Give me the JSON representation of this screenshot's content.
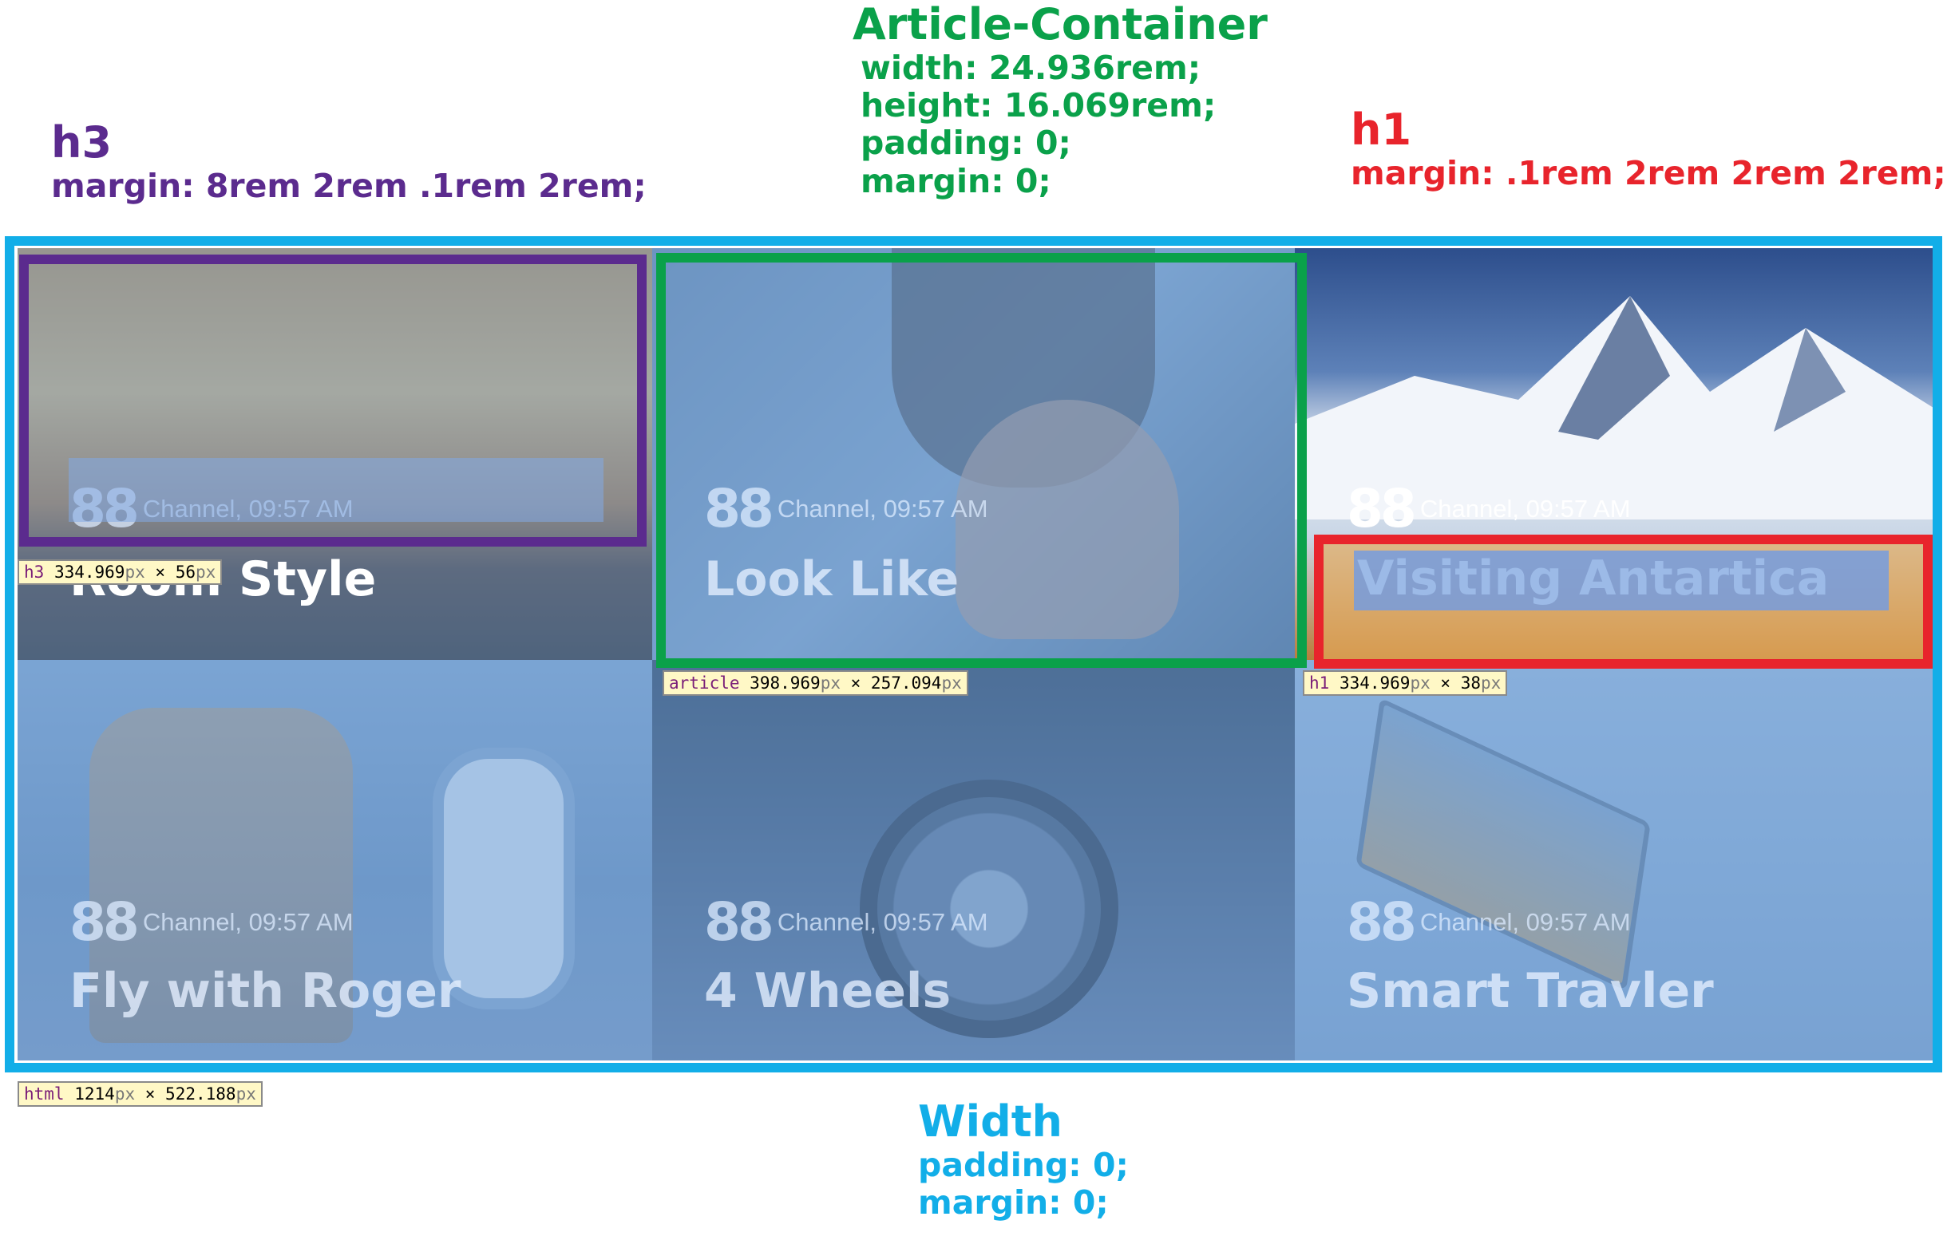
{
  "annotations": {
    "h3": {
      "title": "h3",
      "rule": "margin: 8rem 2rem .1rem 2rem;"
    },
    "article": {
      "title": "Article-Container",
      "lines": [
        "width: 24.936rem;",
        "height: 16.069rem;",
        "padding: 0;",
        "margin: 0;"
      ]
    },
    "h1": {
      "title": "h1",
      "rule": "margin: .1rem 2rem 2rem 2rem;"
    },
    "width": {
      "title": "Width",
      "lines": [
        "padding: 0;",
        "margin: 0;"
      ]
    }
  },
  "tiles": [
    {
      "meta": "Channel, 09:57 AM",
      "headline": "Room Style"
    },
    {
      "meta": "Channel, 09:57 AM",
      "headline": "Look Like"
    },
    {
      "meta": "Channel, 09:57 AM",
      "headline": "Visiting Antartica"
    },
    {
      "meta": "Channel, 09:57 AM",
      "headline": "Fly with Roger"
    },
    {
      "meta": "Channel, 09:57 AM",
      "headline": "4 Wheels"
    },
    {
      "meta": "Channel, 09:57 AM",
      "headline": "Smart Travler"
    }
  ],
  "logo": "88",
  "tooltips": {
    "h3": {
      "tag": "h3",
      "w": "334.969",
      "h": "56",
      "unit": "px"
    },
    "article": {
      "tag": "article",
      "w": "398.969",
      "h": "257.094",
      "unit": "px"
    },
    "h1": {
      "tag": "h1",
      "w": "334.969",
      "h": "38",
      "unit": "px"
    },
    "html": {
      "tag": "html",
      "w": "1214",
      "h": "522.188",
      "unit": "px"
    }
  },
  "colors": {
    "h3": "#5b2b8e",
    "article": "#0aa14a",
    "h1": "#e8242c",
    "width": "#12aee8"
  }
}
